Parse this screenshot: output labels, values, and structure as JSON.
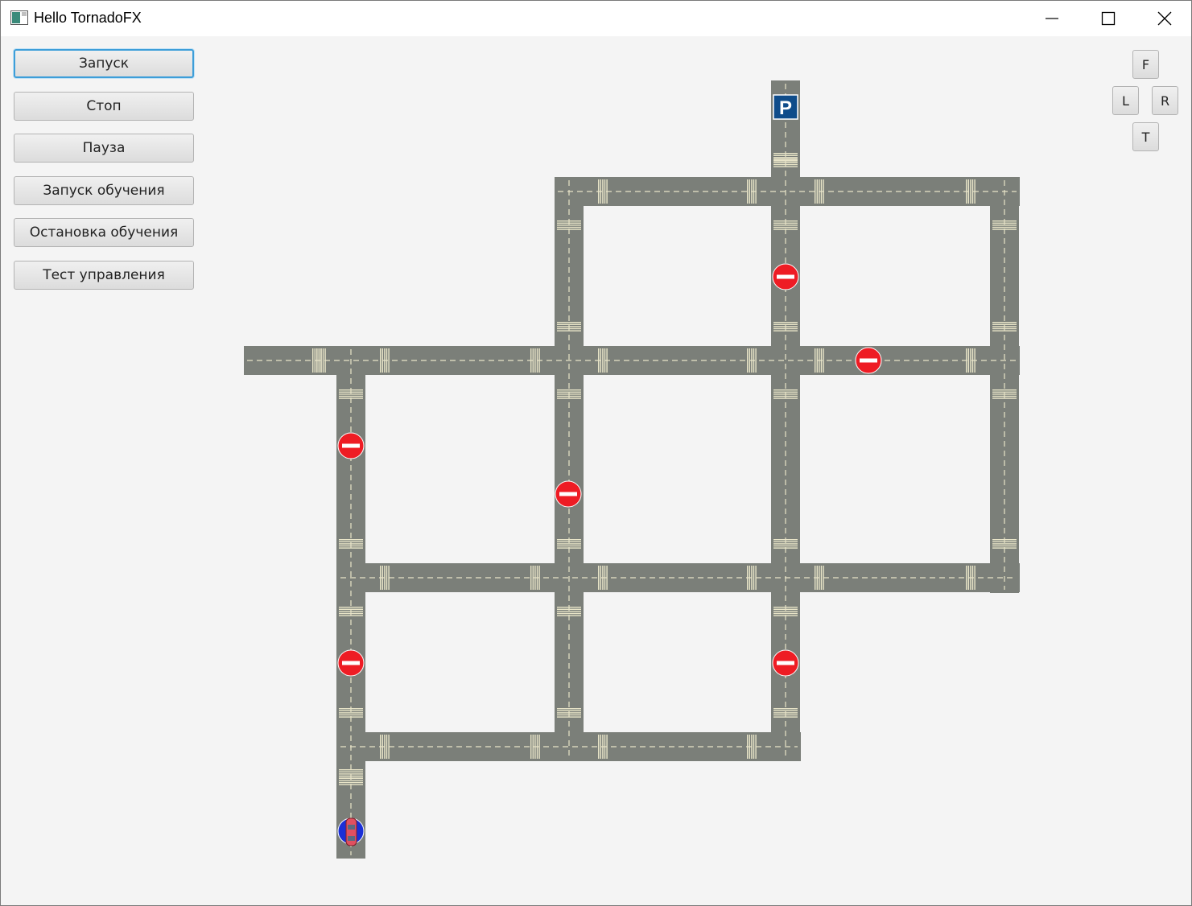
{
  "window": {
    "title": "Hello TornadoFX"
  },
  "controls": {
    "start": "Запуск",
    "stop": "Стоп",
    "pause": "Пауза",
    "start_training": "Запуск обучения",
    "stop_training": "Остановка обучения",
    "test_control": "Тест управления"
  },
  "direction_pad": {
    "forward": "F",
    "left": "L",
    "right": "R",
    "turn": "T"
  },
  "map": {
    "parking_sign": "P",
    "colors": {
      "road": "#7b7f79",
      "lane_marking": "#e8e4c8",
      "no_entry_sign": "#ee1c24",
      "parking_sign": "#0f4c8a",
      "car": "#e05060"
    }
  }
}
